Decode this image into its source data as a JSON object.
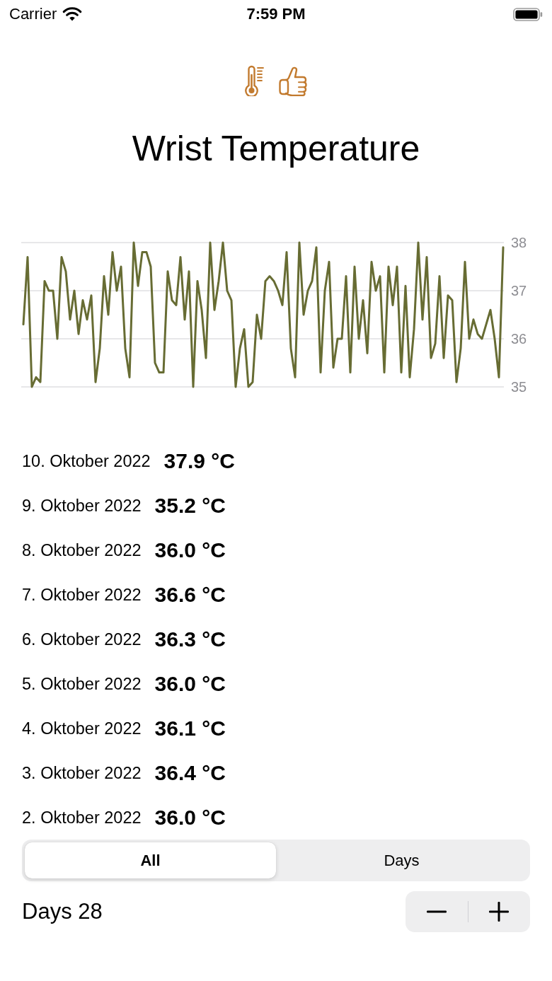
{
  "status_bar": {
    "carrier": "Carrier",
    "time": "7:59 PM"
  },
  "header": {
    "title": "Wrist Temperature"
  },
  "chart": {
    "chart_data": {
      "type": "line",
      "ylim": [
        35,
        38
      ],
      "yticks": [
        35,
        36,
        37,
        38
      ],
      "series": [
        {
          "color": "#676c33",
          "values": [
            36.3,
            37.7,
            35.0,
            35.2,
            35.1,
            37.2,
            37.0,
            37.0,
            36.0,
            37.7,
            37.4,
            36.4,
            37.0,
            36.1,
            36.8,
            36.4,
            36.9,
            35.1,
            35.8,
            37.3,
            36.5,
            37.8,
            37.0,
            37.5,
            35.8,
            35.2,
            38.0,
            37.1,
            37.8,
            37.8,
            37.5,
            35.5,
            35.3,
            35.3,
            37.4,
            36.8,
            36.7,
            37.7,
            36.4,
            37.4,
            35.0,
            37.2,
            36.6,
            35.6,
            38.0,
            36.6,
            37.2,
            38.0,
            37.0,
            36.8,
            35.0,
            35.8,
            36.2,
            35.0,
            35.1,
            36.5,
            36.0,
            37.2,
            37.3,
            37.2,
            37.0,
            36.7,
            37.8,
            35.8,
            35.2,
            38.0,
            36.5,
            37.0,
            37.2,
            37.9,
            35.3,
            37.0,
            37.6,
            35.4,
            36.0,
            36.0,
            37.3,
            35.3,
            37.5,
            36.0,
            36.8,
            35.7,
            37.6,
            37.0,
            37.3,
            35.3,
            37.5,
            36.7,
            37.5,
            35.3,
            37.1,
            35.2,
            36.2,
            38.0,
            36.4,
            37.7,
            35.6,
            35.9,
            37.3,
            35.6,
            36.9,
            36.8,
            35.1,
            35.8,
            37.6,
            36.0,
            36.4,
            36.1,
            36.0,
            36.3,
            36.6,
            36.0,
            35.2,
            37.9
          ]
        }
      ]
    }
  },
  "readings": [
    {
      "date": "10. Oktober 2022",
      "temperature": "37.9 °C"
    },
    {
      "date": "9. Oktober 2022",
      "temperature": "35.2 °C"
    },
    {
      "date": "8. Oktober 2022",
      "temperature": "36.0 °C"
    },
    {
      "date": "7. Oktober 2022",
      "temperature": "36.6 °C"
    },
    {
      "date": "6. Oktober 2022",
      "temperature": "36.3 °C"
    },
    {
      "date": "5. Oktober 2022",
      "temperature": "36.0 °C"
    },
    {
      "date": "4. Oktober 2022",
      "temperature": "36.1 °C"
    },
    {
      "date": "3. Oktober 2022",
      "temperature": "36.4 °C"
    },
    {
      "date": "2. Oktober 2022",
      "temperature": "36.0 °C"
    }
  ],
  "segments": [
    {
      "label": "All",
      "selected": true
    },
    {
      "label": "Days",
      "selected": false
    }
  ],
  "days": {
    "label": "Days 28"
  }
}
